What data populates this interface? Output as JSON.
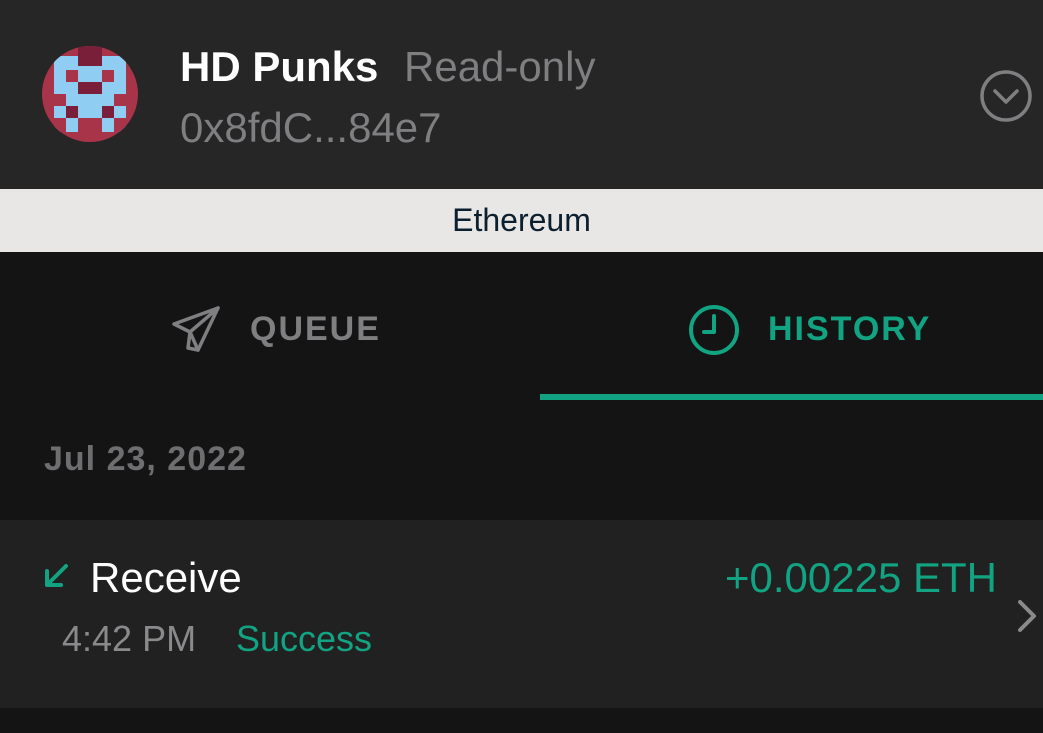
{
  "account": {
    "name": "HD Punks",
    "mode": "Read-only",
    "address": "0x8fdC...84e7"
  },
  "network": {
    "name": "Ethereum"
  },
  "tabs": [
    {
      "label": "QUEUE",
      "icon": "rocket-icon",
      "active": false
    },
    {
      "label": "HISTORY",
      "icon": "clock-icon",
      "active": true
    }
  ],
  "history": {
    "date": "Jul 23, 2022",
    "transactions": [
      {
        "type": "Receive",
        "amount": "+0.00225 ETH",
        "time": "4:42 PM",
        "status": "Success",
        "direction_icon": "arrow-down-left-icon"
      }
    ]
  },
  "colors": {
    "accent": "#12a383",
    "header_bg": "#262626",
    "page_bg": "#141414",
    "row_bg": "#212121",
    "banner_bg": "#e8e7e5",
    "muted_text": "#7f7f82",
    "avatar_red": "#a8344a",
    "avatar_blue": "#8fcdf2",
    "avatar_dark": "#7a1f3a"
  }
}
